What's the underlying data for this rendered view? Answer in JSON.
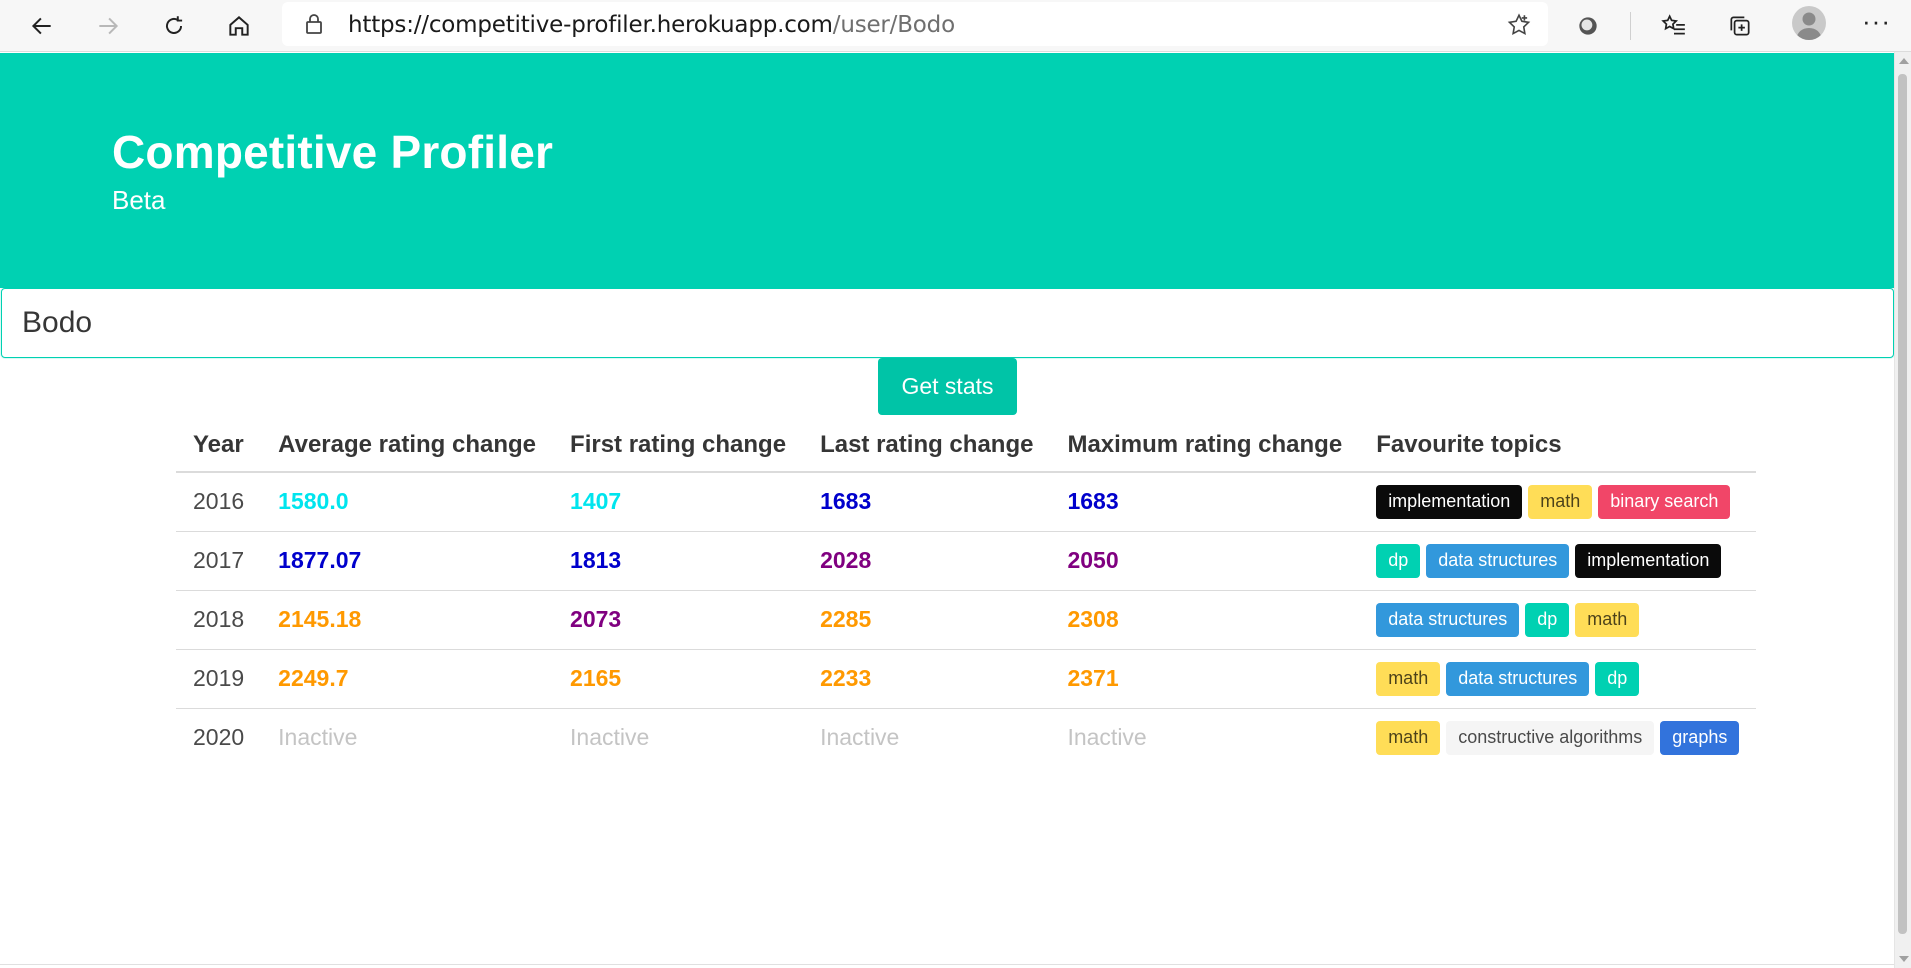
{
  "browser": {
    "url_host": "https://competitive-profiler.herokuapp.com",
    "url_path": "/user/Bodo"
  },
  "hero": {
    "title": "Competitive Profiler",
    "subtitle": "Beta"
  },
  "search": {
    "value": "Bodo"
  },
  "button": {
    "label": "Get stats"
  },
  "table": {
    "headers": [
      "Year",
      "Average rating change",
      "First rating change",
      "Last rating change",
      "Maximum rating change",
      "Favourite topics"
    ],
    "rows": [
      {
        "year": "2016",
        "avg": {
          "text": "1580.0",
          "color": "#00e5ee"
        },
        "first": {
          "text": "1407",
          "color": "#00e5ee"
        },
        "last": {
          "text": "1683",
          "color": "#0000cc"
        },
        "max": {
          "text": "1683",
          "color": "#0000cc"
        },
        "topics": [
          {
            "label": "implementation",
            "style": "black"
          },
          {
            "label": "math",
            "style": "yellow"
          },
          {
            "label": "binary search",
            "style": "red"
          }
        ]
      },
      {
        "year": "2017",
        "avg": {
          "text": "1877.07",
          "color": "#0000cc"
        },
        "first": {
          "text": "1813",
          "color": "#0000cc"
        },
        "last": {
          "text": "2028",
          "color": "#800080"
        },
        "max": {
          "text": "2050",
          "color": "#800080"
        },
        "topics": [
          {
            "label": "dp",
            "style": "teal"
          },
          {
            "label": "data structures",
            "style": "blue"
          },
          {
            "label": "implementation",
            "style": "black"
          }
        ]
      },
      {
        "year": "2018",
        "avg": {
          "text": "2145.18",
          "color": "#ff9900"
        },
        "first": {
          "text": "2073",
          "color": "#800080"
        },
        "last": {
          "text": "2285",
          "color": "#ff9900"
        },
        "max": {
          "text": "2308",
          "color": "#ff9900"
        },
        "topics": [
          {
            "label": "data structures",
            "style": "blue"
          },
          {
            "label": "dp",
            "style": "teal"
          },
          {
            "label": "math",
            "style": "yellow"
          }
        ]
      },
      {
        "year": "2019",
        "avg": {
          "text": "2249.7",
          "color": "#ff9900"
        },
        "first": {
          "text": "2165",
          "color": "#ff9900"
        },
        "last": {
          "text": "2233",
          "color": "#ff9900"
        },
        "max": {
          "text": "2371",
          "color": "#ff9900"
        },
        "topics": [
          {
            "label": "math",
            "style": "yellow"
          },
          {
            "label": "data structures",
            "style": "blue"
          },
          {
            "label": "dp",
            "style": "teal"
          }
        ]
      },
      {
        "year": "2020",
        "avg": {
          "text": "Inactive",
          "color": "inactive"
        },
        "first": {
          "text": "Inactive",
          "color": "inactive"
        },
        "last": {
          "text": "Inactive",
          "color": "inactive"
        },
        "max": {
          "text": "Inactive",
          "color": "inactive"
        },
        "topics": [
          {
            "label": "math",
            "style": "yellow"
          },
          {
            "label": "constructive algorithms",
            "style": "light"
          },
          {
            "label": "graphs",
            "style": "link"
          }
        ]
      }
    ]
  }
}
